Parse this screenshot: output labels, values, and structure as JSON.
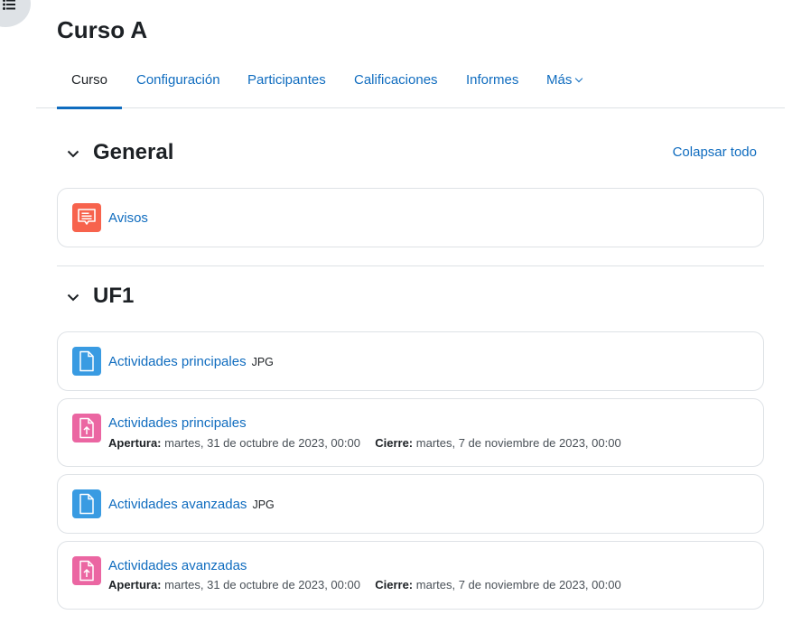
{
  "course": {
    "title": "Curso A"
  },
  "tabs": [
    {
      "label": "Curso",
      "active": true
    },
    {
      "label": "Configuración"
    },
    {
      "label": "Participantes"
    },
    {
      "label": "Calificaciones"
    },
    {
      "label": "Informes"
    },
    {
      "label": "Más"
    }
  ],
  "colors": {
    "link": "#0f6cbf",
    "file_icon": "#399be2",
    "assign_icon": "#eb66a2",
    "forum_icon": "#f7634d"
  },
  "sections": [
    {
      "title": "General",
      "collapse_all_label": "Colapsar todo",
      "activities": [
        {
          "name": "Avisos",
          "icon": "forum-icon"
        }
      ]
    },
    {
      "title": "UF1",
      "activities": [
        {
          "name": "Actividades principales",
          "icon": "file-icon",
          "badge": "JPG"
        },
        {
          "name": "Actividades principales",
          "icon": "assignment-upload-icon",
          "open_label": "Apertura:",
          "open_value": "martes, 31 de octubre de 2023, 00:00",
          "close_label": "Cierre:",
          "close_value": "martes, 7 de noviembre de 2023, 00:00"
        },
        {
          "name": "Actividades avanzadas",
          "icon": "file-icon",
          "badge": "JPG"
        },
        {
          "name": "Actividades avanzadas",
          "icon": "assignment-upload-icon",
          "open_label": "Apertura:",
          "open_value": "martes, 31 de octubre de 2023, 00:00",
          "close_label": "Cierre:",
          "close_value": "martes, 7 de noviembre de 2023, 00:00"
        }
      ]
    }
  ]
}
